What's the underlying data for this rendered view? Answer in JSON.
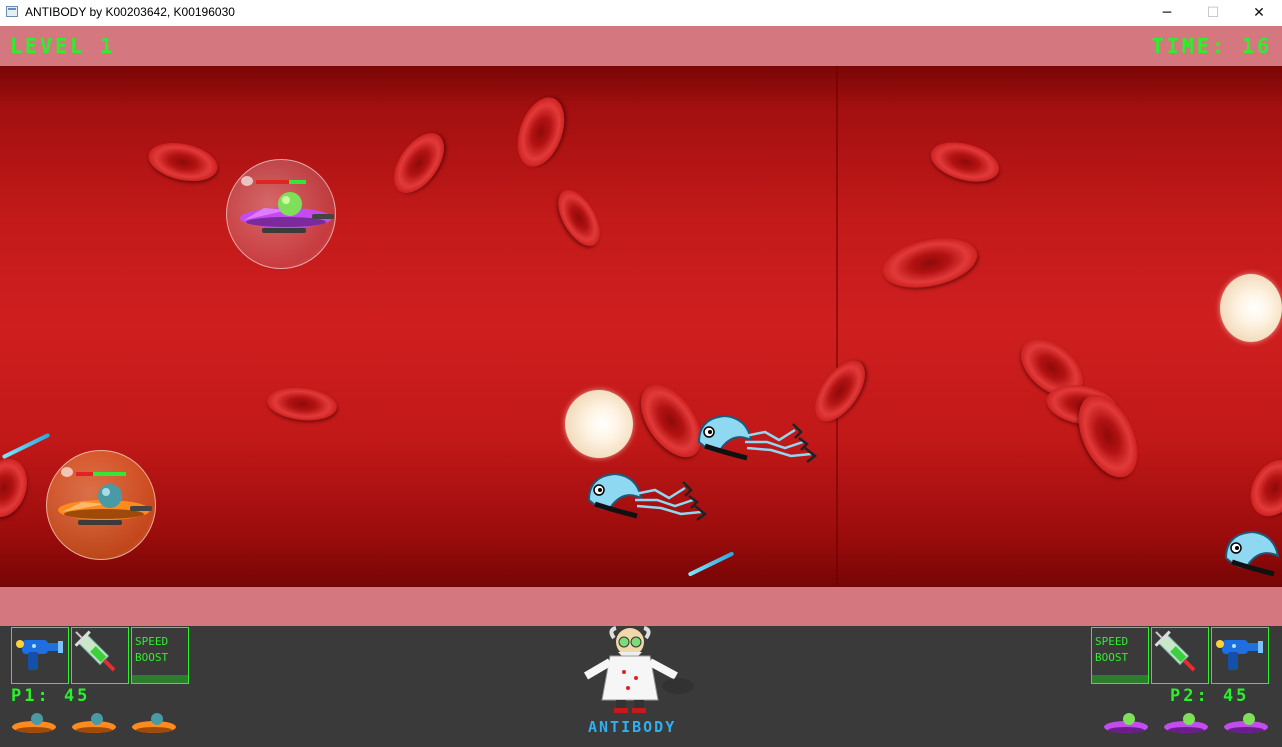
{
  "window": {
    "title": "ANTIBODY by K00203642, K00196030",
    "minimize_glyph": "─",
    "maximize_glyph": "☐",
    "close_glyph": "✕"
  },
  "hud": {
    "level_label": "LEVEL 1",
    "time_label": "TIME: 16"
  },
  "player1": {
    "score_label": "P1: 45",
    "weapons": [
      "raygun-icon",
      "syringe-icon"
    ],
    "speed_boost_line1": "SPEED",
    "speed_boost_line2": "BOOST",
    "lives": 3,
    "ship_color": "#ff8a1e",
    "health_fraction": 0.4
  },
  "player2": {
    "score_label": "P2: 45",
    "weapons": [
      "syringe-icon",
      "raygun-icon"
    ],
    "speed_boost_line1": "SPEED",
    "speed_boost_line2": "BOOST",
    "lives": 3,
    "ship_color": "#c34cf0",
    "health_fraction": 0.2
  },
  "footer": {
    "logo_text": "ANTIBODY"
  },
  "colors": {
    "hud_green": "#2cf02c",
    "hud_band": "#d5777f",
    "blood": "#c41a1a",
    "panel": "#3a3a3a",
    "logo_blue": "#2fb0f0"
  }
}
